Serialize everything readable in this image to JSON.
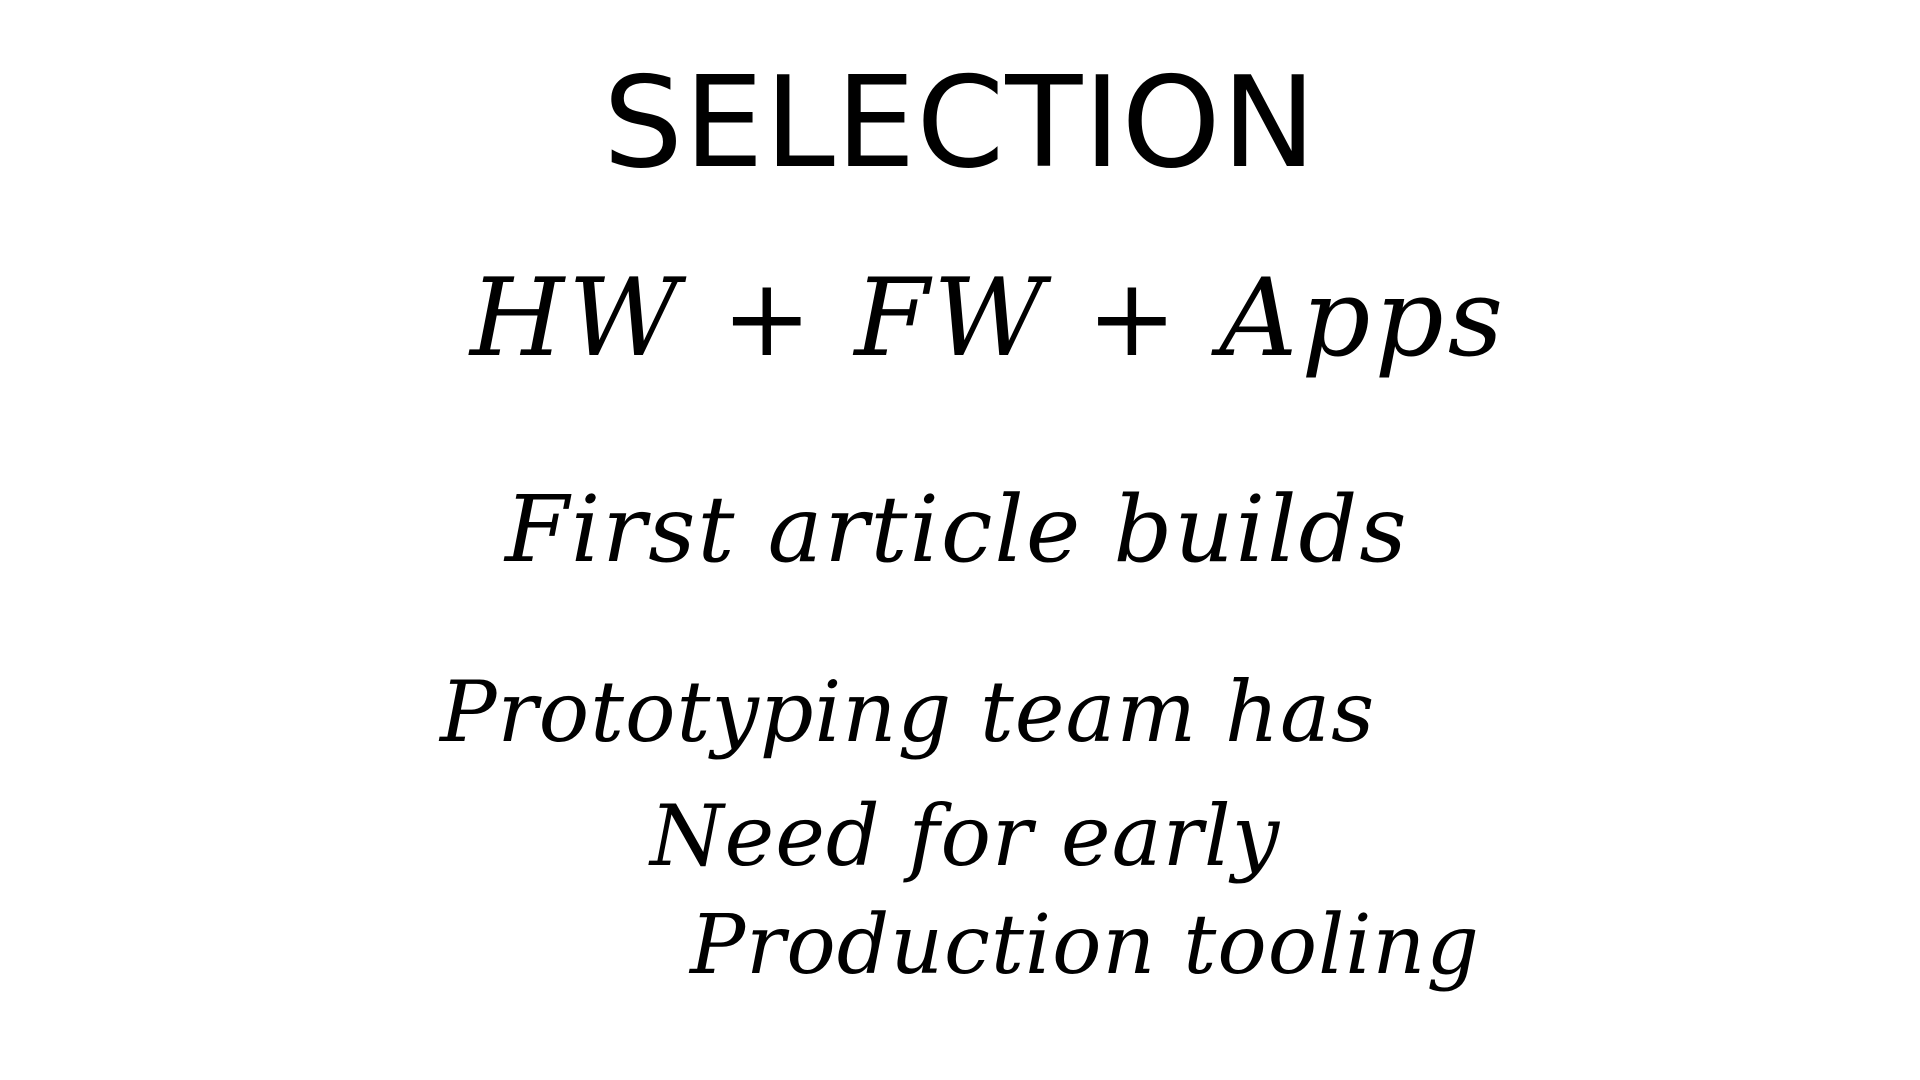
{
  "slide": {
    "title": "SELECTION",
    "lines": [
      "HW + FW + Apps",
      "First article builds",
      "Prototyping team has",
      "Need for early",
      "Production tooling"
    ],
    "colors": {
      "background": "#ffffff",
      "text": "#000000"
    }
  }
}
